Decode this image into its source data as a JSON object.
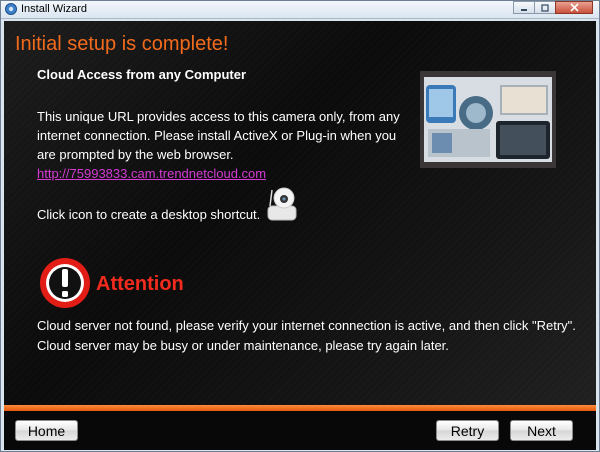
{
  "window": {
    "title": "Install Wizard",
    "icon": "wizard-app-icon",
    "controls": [
      "minimize",
      "maximize",
      "close"
    ]
  },
  "main": {
    "heading": "Initial setup is complete!",
    "subheading": "Cloud Access from any Computer",
    "description": "This unique URL provides access to this camera only, from any internet connection. Please install ActiveX or Plug-in when you are prompted by the web browser.",
    "url": "http://75993833.cam.trendnetcloud.com",
    "shortcut_text": "Click icon to create a desktop shortcut.",
    "shortcut_icon": "camera-icon",
    "attention": {
      "icon": "exclamation-icon",
      "title": "Attention",
      "line1": "Cloud server not found, please verify your internet connection is active, and then click \"Retry\".",
      "line2": "Cloud server may be busy or under maintenance, please try again later."
    }
  },
  "footer": {
    "home_label": "Home",
    "retry_label": "Retry",
    "next_label": "Next"
  },
  "colors": {
    "heading": "#f26b1d",
    "attention": "#f12b1d",
    "link": "#d63ad6",
    "accent_bar": "#f0701f"
  }
}
